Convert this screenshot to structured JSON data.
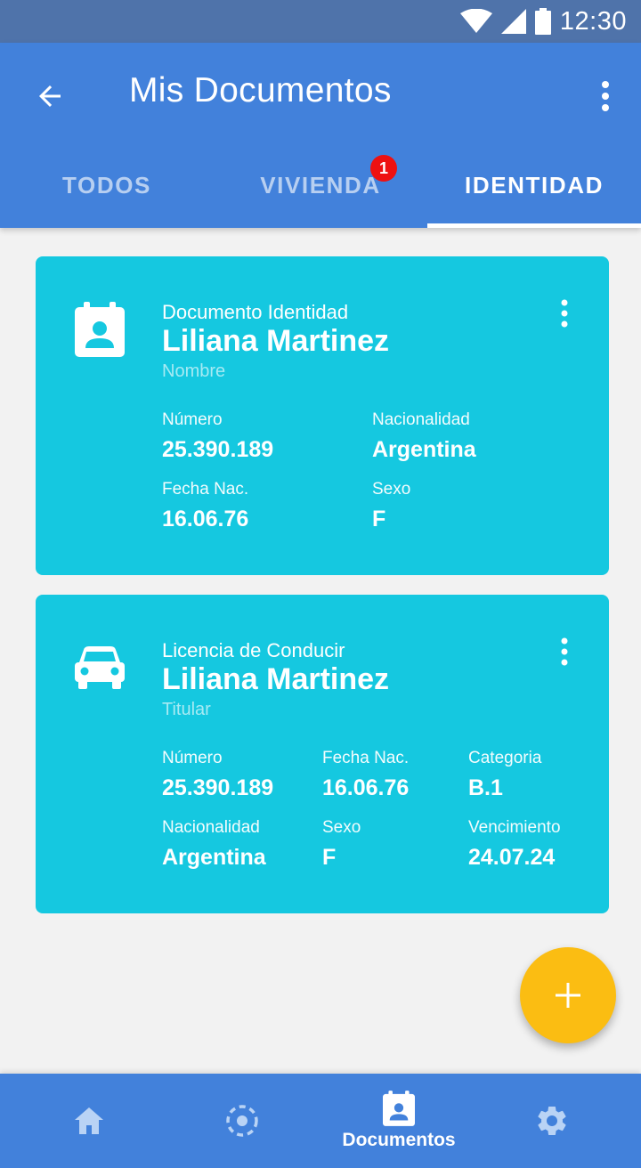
{
  "status_bar": {
    "time": "12:30",
    "icons": [
      "wifi-icon",
      "signal-icon",
      "battery-icon"
    ]
  },
  "app_bar": {
    "title": "Mis Documentos",
    "back_icon": "arrow-back-icon",
    "menu_icon": "more-vert-icon"
  },
  "tabs": [
    {
      "label": "TODOS",
      "active": false
    },
    {
      "label": "VIVIENDA",
      "active": false,
      "badge": "1"
    },
    {
      "label": "IDENTIDAD",
      "active": true
    }
  ],
  "cards": [
    {
      "icon": "contact-card-icon",
      "type": "Documento Identidad",
      "holder": "Liliana Martinez",
      "holder_role": "Nombre",
      "fields": [
        {
          "label": "Número",
          "value": "25.390.189"
        },
        {
          "label": "Nacionalidad",
          "value": "Argentina"
        },
        {
          "label": "Fecha Nac.",
          "value": "16.06.76"
        },
        {
          "label": "Sexo",
          "value": "F"
        }
      ]
    },
    {
      "icon": "car-icon",
      "type": "Licencia de Conducir",
      "holder": "Liliana Martinez",
      "holder_role": "Titular",
      "fields": [
        {
          "label": "Número",
          "value": "25.390.189"
        },
        {
          "label": "Fecha Nac.",
          "value": "16.06.76"
        },
        {
          "label": "Categoria",
          "value": "B.1"
        },
        {
          "label": "Nacionalidad",
          "value": "Argentina"
        },
        {
          "label": "Sexo",
          "value": "F"
        },
        {
          "label": "Vencimiento",
          "value": "24.07.24"
        }
      ]
    }
  ],
  "fab": {
    "icon": "add-icon"
  },
  "bottom_nav": [
    {
      "icon": "home-icon",
      "label": "",
      "active": false
    },
    {
      "icon": "target-icon",
      "label": "",
      "active": false
    },
    {
      "icon": "contact-card-icon",
      "label": "Documentos",
      "active": true
    },
    {
      "icon": "gear-icon",
      "label": "",
      "active": false
    }
  ],
  "colors": {
    "status_bar": "#4f73aa",
    "primary": "#4281db",
    "card": "#15c8e0",
    "fab": "#fbbd12",
    "badge": "#ee1111",
    "background": "#f2f2f2"
  }
}
